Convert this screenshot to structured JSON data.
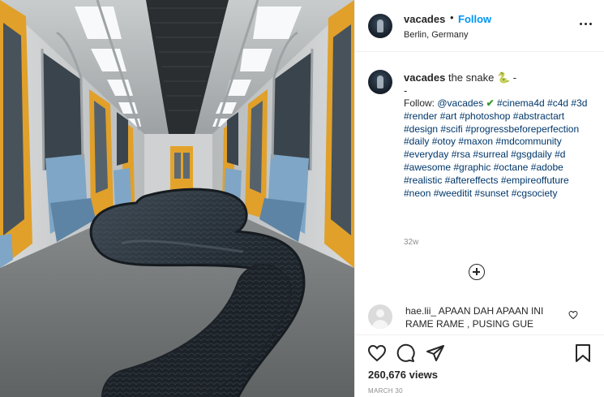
{
  "post": {
    "username": "vacades",
    "separator": "•",
    "follow_label": "Follow",
    "location": "Berlin, Germany"
  },
  "caption": {
    "username": "vacades",
    "title": "the snake 🐍 -",
    "dash": "-",
    "follow_prefix": "Follow: ",
    "mention": "@vacades",
    "check": "✔",
    "hashtags_first": "#cinema4d",
    "hashtags": "#c4d #3d #render #art #photoshop #abstractart #design #scifi #progressbeforeperfection #daily #otoy #maxon #mdcommunity #everyday #rsa #surreal #gsgdaily #d #awesome #graphic #octane #adobe #realistic #aftereffects #empireoffuture #neon #weeditit #sunset #cgsociety",
    "time_ago": "32w"
  },
  "comment": {
    "username": "hae.lii_",
    "text": "APAAN DAH APAAN INI RAME RAME , PUSING GUE"
  },
  "stats": {
    "views": "260,676 views",
    "date": "MARCH 30"
  },
  "icons": {
    "more": "more-options-icon",
    "load_more": "plus-circle-icon",
    "like": "heart-icon",
    "comment": "comment-icon",
    "share": "share-icon",
    "save": "bookmark-icon"
  },
  "colors": {
    "link_blue": "#0095f6",
    "hashtag": "#00376b",
    "muted": "#8e8e8e",
    "subway_seat": "#7fa6c6",
    "subway_door": "#e3a32b",
    "snake": "#27313a"
  }
}
